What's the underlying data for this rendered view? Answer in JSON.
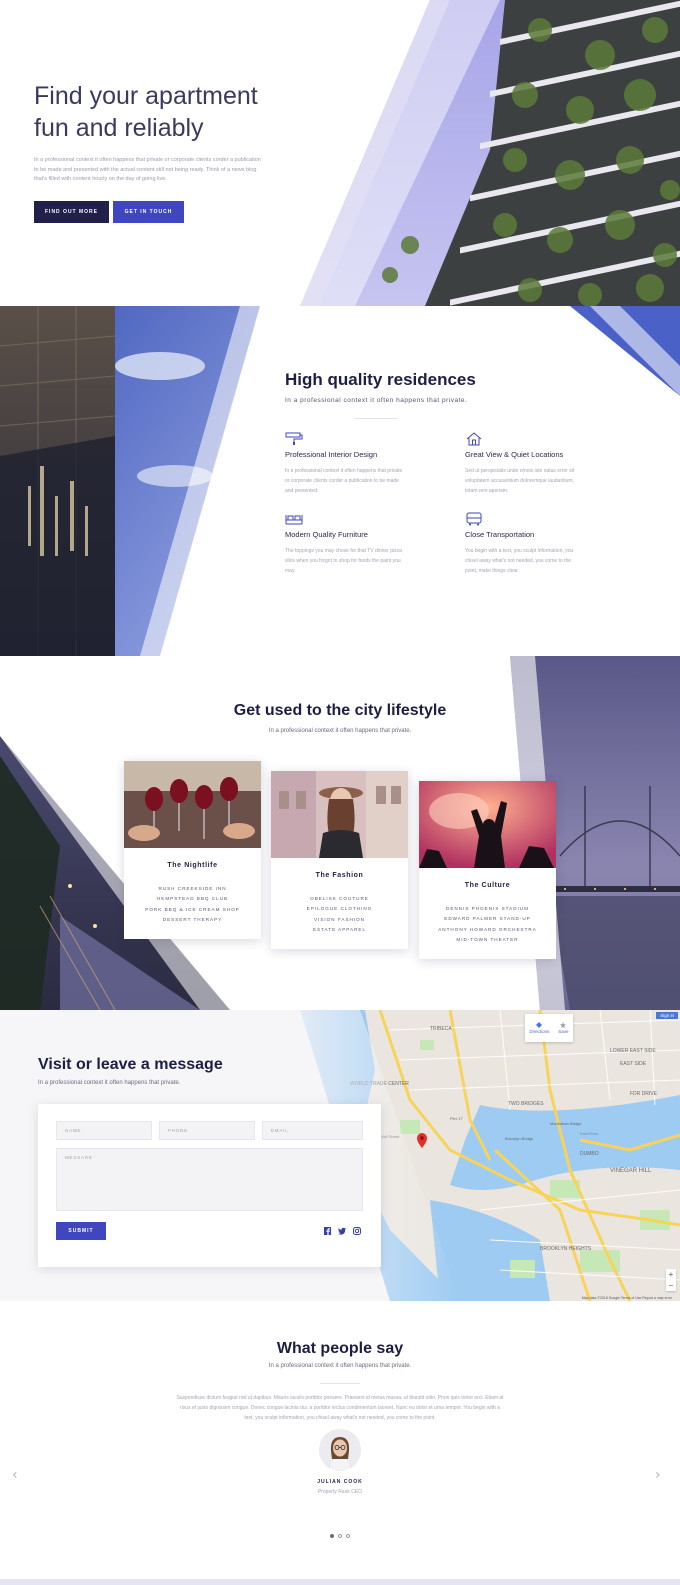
{
  "hero": {
    "title_line1": "Find your apartment",
    "title_line2": "fun and reliably",
    "text": "In a professional context it often happens that private or corporate clients corder a publication to be made and presented with the actual content still not being ready. Think of a news blog that's filled with content hourly on the day of going live.",
    "primary_button": "FIND OUT MORE",
    "secondary_button": "GET IN TOUCH"
  },
  "residences": {
    "title": "High quality residences",
    "subtitle": "In a professional context it often happens that private.",
    "features": [
      {
        "icon": "paint-roller-icon",
        "title": "Professional Interior Design",
        "text": "In a professional context it often happens that private or corporate clients corder a publication to be made and presented."
      },
      {
        "icon": "house-icon",
        "title": "Great View & Quiet Locations",
        "text": "Sed ut perspiciatis unde omnis iste natus error sit voluptatem accusantium doloremque laudantium, totam rem aperiam."
      },
      {
        "icon": "bed-icon",
        "title": "Modern Quality Furniture",
        "text": "The toppings you may chose for that TV dinner pizza slice when you forgot to shop for foods the paint you may."
      },
      {
        "icon": "bus-icon",
        "title": "Close Transportation",
        "text": "You begin with a text, you sculpt information, you chisel away what's not needed, you come to the point, make things clear."
      }
    ]
  },
  "lifestyle": {
    "title": "Get used to the city lifestyle",
    "subtitle": "In a professional context it often happens that private.",
    "cards": [
      {
        "title": "The Nightlife",
        "items": [
          "RUSH CREEKSIDE INN",
          "HEMPSTEAD BBQ CLUB",
          "PORK BBQ & ICE CREAM SHOP",
          "DESSERT THERAPY"
        ]
      },
      {
        "title": "The Fashion",
        "items": [
          "OBELISK COUTURE",
          "EPILOGUE CLOTHING",
          "VISION FASHION",
          "ESTATE APPAREL"
        ]
      },
      {
        "title": "The Culture",
        "items": [
          "DENNIS PHOENIX STADIUM",
          "EDWARD PALMER STAND-UP",
          "ANTHONY HOWARD ORCHESTRA",
          "MID-TOWN THEATER"
        ]
      }
    ]
  },
  "contact": {
    "title": "Visit or leave a message",
    "subtitle": "In a professional context it often happens that private.",
    "fields": {
      "name": "NAME",
      "phone": "PHONE",
      "email": "EMAIL",
      "message": "MESSAGE"
    },
    "submit": "SUBMIT",
    "socials": [
      "facebook-icon",
      "twitter-icon",
      "instagram-icon"
    ],
    "map": {
      "directions": "Directions",
      "save": "Save",
      "sign_in": "Sign in",
      "attribution": "Map data ©2018 Google   Terms of Use   Report a map error",
      "labels": [
        "TRIBECA",
        "LOWER EAST SIDE",
        "EAST SIDE",
        "WORLD TRADE CENTER",
        "TWO BRIDGES",
        "FDR DRIVE",
        "DUMBO",
        "VINEGAR HILL",
        "BROOKLYN HEIGHTS",
        "Brooklyn Bridge",
        "Manhattan Bridge",
        "East River",
        "Pier 17",
        "Wall Street"
      ]
    }
  },
  "testimonials": {
    "title": "What people say",
    "subtitle": "In a professional context it often happens that private.",
    "quote": "Suspendisse dictum feugiat nisl ut dapibus. Mauris iaculis porttitor posuere. Praesent id metus massa, ut blandit odio. Proin quis tortor orci. Etiam at risus et justo dignissim congue. Donec congue lacinia dui, a porttitor lectus condimentum laoreet. Nunc eu dolor et urna tempor. You begin with a text, you sculpt information, you chisel away what's not needed, you come to the point.",
    "name": "JULIAN COOK",
    "role": "Property Rank CEO",
    "prev": "‹",
    "next": "›"
  },
  "colors": {
    "accent": "#4046c0",
    "dark": "#20204a",
    "heading": "#1e1e44",
    "lavender": "#e4e4f4"
  }
}
